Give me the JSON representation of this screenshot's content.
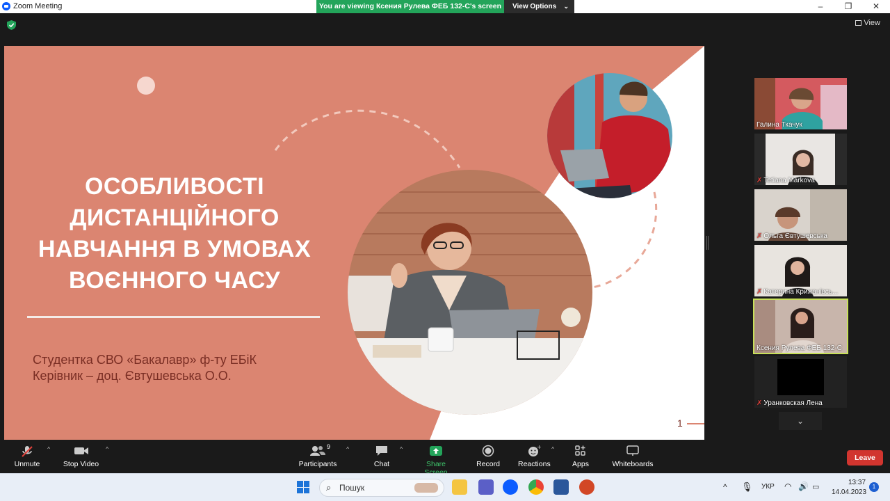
{
  "window": {
    "title": "Zoom Meeting",
    "viewing_banner": "You are viewing Ксения Рулева ФЕБ 132-С's screen",
    "view_options": "View Options",
    "view_label": "View",
    "minimize": "–",
    "maximize": "❐",
    "close": "✕"
  },
  "slide": {
    "title_lines": [
      "ОСОБЛИВОСТІ",
      "ДИСТАНЦІЙНОГО",
      "НАВЧАННЯ В УМОВАХ",
      "ВОЄННОГО ЧАСУ"
    ],
    "subtitle_line1": "Студентка СВО «Бакалавр» ф-ту ЕБіК",
    "subtitle_line2": "Керівник – доц. Євтушевська О.О.",
    "page_number": "1",
    "colors": {
      "background": "#db8571",
      "title": "#ffffff",
      "subtitle": "#7a2e24"
    }
  },
  "participants": [
    {
      "name": "Галина Ткачук",
      "muted": false,
      "active": false
    },
    {
      "name": "Tetiana Markova",
      "muted": true,
      "active": false
    },
    {
      "name": "Ольга Євтушевська",
      "muted": true,
      "active": false
    },
    {
      "name": "Катерина Крижанівсь...",
      "muted": true,
      "active": false
    },
    {
      "name": "Ксения Рулева ФЕБ 132-С",
      "muted": false,
      "active": true
    },
    {
      "name": "Уранковская Лена",
      "muted": true,
      "active": false
    }
  ],
  "toolbar": {
    "unmute": "Unmute",
    "stop_video": "Stop Video",
    "participants": "Participants",
    "participants_count": "9",
    "chat": "Chat",
    "share_screen": "Share Screen",
    "record": "Record",
    "reactions": "Reactions",
    "apps": "Apps",
    "whiteboards": "Whiteboards",
    "leave": "Leave"
  },
  "taskbar": {
    "search_placeholder": "Пошук",
    "language": "УКР",
    "time": "13:37",
    "date": "14.04.2023",
    "notifications": "1"
  }
}
